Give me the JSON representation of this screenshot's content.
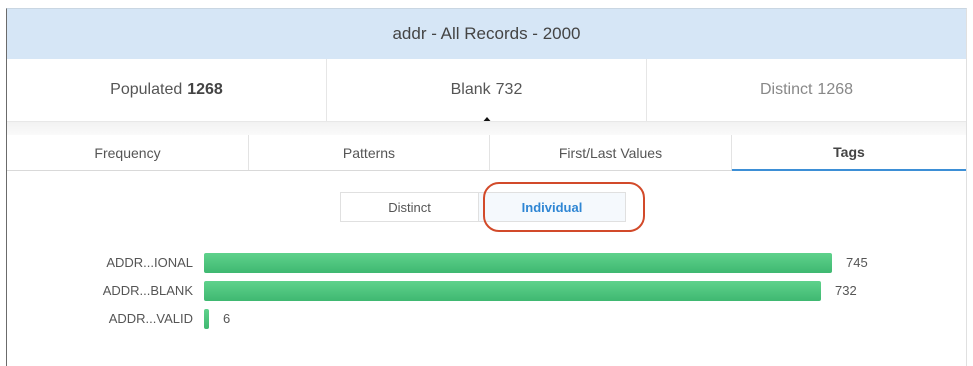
{
  "header": {
    "title": "addr - All Records - 2000"
  },
  "stats": [
    {
      "label": "Populated",
      "value": "1268"
    },
    {
      "label": "Blank",
      "value": "732"
    },
    {
      "label": "Distinct",
      "value": "1268"
    }
  ],
  "tabs": [
    {
      "label": "Frequency"
    },
    {
      "label": "Patterns"
    },
    {
      "label": "First/Last Values"
    },
    {
      "label": "Tags",
      "active": true
    }
  ],
  "toggle": {
    "distinct_label": "Distinct",
    "individual_label": "Individual",
    "selected": "Individual"
  },
  "colors": {
    "bar": "#45c077",
    "accent": "#2f86d4",
    "highlight": "#d24a2a",
    "header_bg": "#d6e6f6"
  },
  "chart_data": {
    "type": "bar",
    "orientation": "horizontal",
    "categories": [
      "ADDR...IONAL",
      "ADDR...BLANK",
      "ADDR...VALID"
    ],
    "values": [
      745,
      732,
      6
    ],
    "xlim": [
      0,
      745
    ]
  }
}
